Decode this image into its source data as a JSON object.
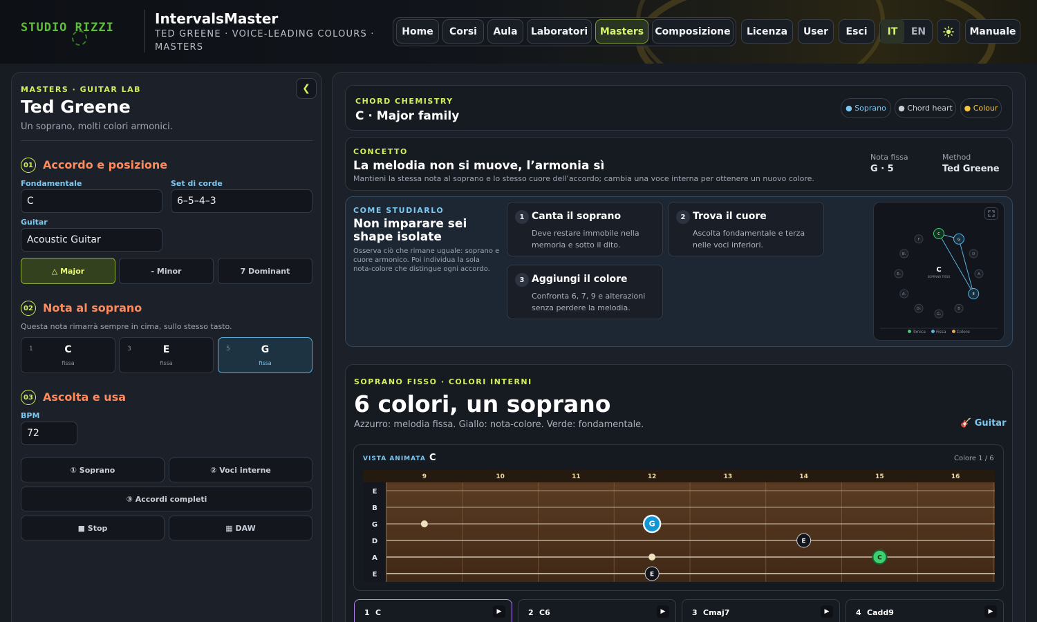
{
  "header": {
    "logo": "STUDIO RIZZI",
    "app_title": "IntervalsMaster",
    "app_subtitle": "TED GREENE · VOICE-LEADING COLOURS · MASTERS",
    "nav": [
      "Home",
      "Corsi",
      "Aula",
      "Laboratori",
      "Masters",
      "Composizione"
    ],
    "nav_active": "Masters",
    "nav_right": [
      "Licenza",
      "User",
      "Esci"
    ],
    "lang_it": "IT",
    "lang_en": "EN",
    "lang_active": "IT",
    "theme_icon": "sun-icon",
    "manual_label": "Manuale"
  },
  "left": {
    "eyebrow": "MASTERS · GUITAR LAB",
    "title": "Ted Greene",
    "subtitle": "Un soprano, molti colori armonici.",
    "collapse_icon": "❮",
    "section1": {
      "num": "01",
      "title": "Accordo e posizione",
      "root_label": "Fondamentale",
      "root_value": "C",
      "set_label": "Set di corde",
      "set_value": "6–5–4–3",
      "guitar_label": "Guitar",
      "guitar_value": "Acoustic Guitar",
      "qualities": [
        "△ Major",
        "- Minor",
        "7 Dominant"
      ],
      "quality_active": 0
    },
    "section2": {
      "num": "02",
      "title": "Nota al soprano",
      "hint": "Questa nota rimarrà sempre in cima, sullo stesso tasto.",
      "notes": [
        {
          "degree": "1",
          "name": "C",
          "state": "fissa"
        },
        {
          "degree": "3",
          "name": "E",
          "state": "fissa"
        },
        {
          "degree": "5",
          "name": "G",
          "state": "fissa"
        }
      ],
      "note_active": 2
    },
    "section3": {
      "num": "03",
      "title": "Ascolta e usa",
      "bpm_label": "BPM",
      "bpm_value": "72",
      "btn_soprano": "① Soprano",
      "btn_inner": "② Voci interne",
      "btn_full": "③ Accordi completi",
      "btn_stop": "■ Stop",
      "btn_daw": "▦ DAW"
    }
  },
  "chemistry": {
    "eyebrow": "CHORD CHEMISTRY",
    "title": "C · Major family",
    "pills": [
      {
        "label": "● Soprano",
        "color": "#7cc8f2"
      },
      {
        "label": "● Chord heart",
        "color": "#c9cfd8"
      },
      {
        "label": "● Colour",
        "color": "#f5c542"
      }
    ]
  },
  "concept": {
    "eyebrow": "CONCETTO",
    "title": "La melodia non si muove, l’armonia sì",
    "text": "Mantieni la stessa nota al soprano e lo stesso cuore dell’accordo; cambia una voce interna per ottenere un nuovo colore.",
    "fixed_label": "Nota fissa",
    "fixed_value": "G · 5",
    "method_label": "Method",
    "method_value": "Ted Greene"
  },
  "study": {
    "eyebrow": "COME STUDIARLO",
    "title": "Non imparare sei shape isolate",
    "text": "Osserva ciò che rimane uguale: soprano e cuore armonico. Poi individua la sola nota-colore che distingue ogni accordo.",
    "steps": [
      {
        "num": "1",
        "title": "Canta il soprano",
        "desc": "Deve restare immobile nella memoria e sotto il dito."
      },
      {
        "num": "2",
        "title": "Trova il cuore",
        "desc": "Ascolta fondamentale e terza nelle voci inferiori."
      },
      {
        "num": "3",
        "title": "Aggiungi il colore",
        "desc": "Confronta 6, 7, 9 e alterazioni senza perdere la melodia."
      }
    ],
    "circle": {
      "center": "C",
      "center_sub": "SOPRANO FISSO",
      "expand_icon": "expand-icon",
      "nodes": [
        "C",
        "G",
        "D",
        "A",
        "E",
        "B",
        "G♭",
        "D♭",
        "A♭",
        "E♭",
        "B♭",
        "F"
      ],
      "legend": [
        {
          "label": "Tonica",
          "color": "#3ecf6e"
        },
        {
          "label": "Fissa",
          "color": "#5ab4e4"
        },
        {
          "label": "Colore",
          "color": "#f5a642"
        }
      ]
    }
  },
  "soprano": {
    "eyebrow": "SOPRANO FISSO · COLORI INTERNI",
    "title": "6 colori, un soprano",
    "subtitle": "Azzurro: melodia fissa. Giallo: nota-colore. Verde: fondamentale.",
    "instrument_label": "🎸 Guitar",
    "view_label": "VISTA ANIMATA",
    "view_chord": "C",
    "counter": "Colore 1 / 6",
    "fretboard": {
      "frets": [
        "9",
        "10",
        "11",
        "12",
        "13",
        "14",
        "15",
        "16"
      ],
      "strings": [
        "E",
        "B",
        "G",
        "D",
        "A",
        "E"
      ],
      "notes": [
        {
          "string": 2,
          "fret": 12,
          "label": "G",
          "kind": "soprano"
        },
        {
          "string": 3,
          "fret": 14,
          "label": "E",
          "kind": "heart"
        },
        {
          "string": 4,
          "fret": 15,
          "label": "C",
          "kind": "root"
        },
        {
          "string": 5,
          "fret": 12,
          "label": "E",
          "kind": "heart"
        },
        {
          "string": 2,
          "fret": 9,
          "label": "",
          "kind": "ghost"
        },
        {
          "string": 4,
          "fret": 12,
          "label": "",
          "kind": "ghost"
        }
      ]
    },
    "chords": [
      {
        "num": "1",
        "name": "C"
      },
      {
        "num": "2",
        "name": "C6"
      },
      {
        "num": "3",
        "name": "Cmaj7"
      },
      {
        "num": "4",
        "name": "Cadd9"
      }
    ],
    "chord_active": 0,
    "play_icon": "▶"
  }
}
